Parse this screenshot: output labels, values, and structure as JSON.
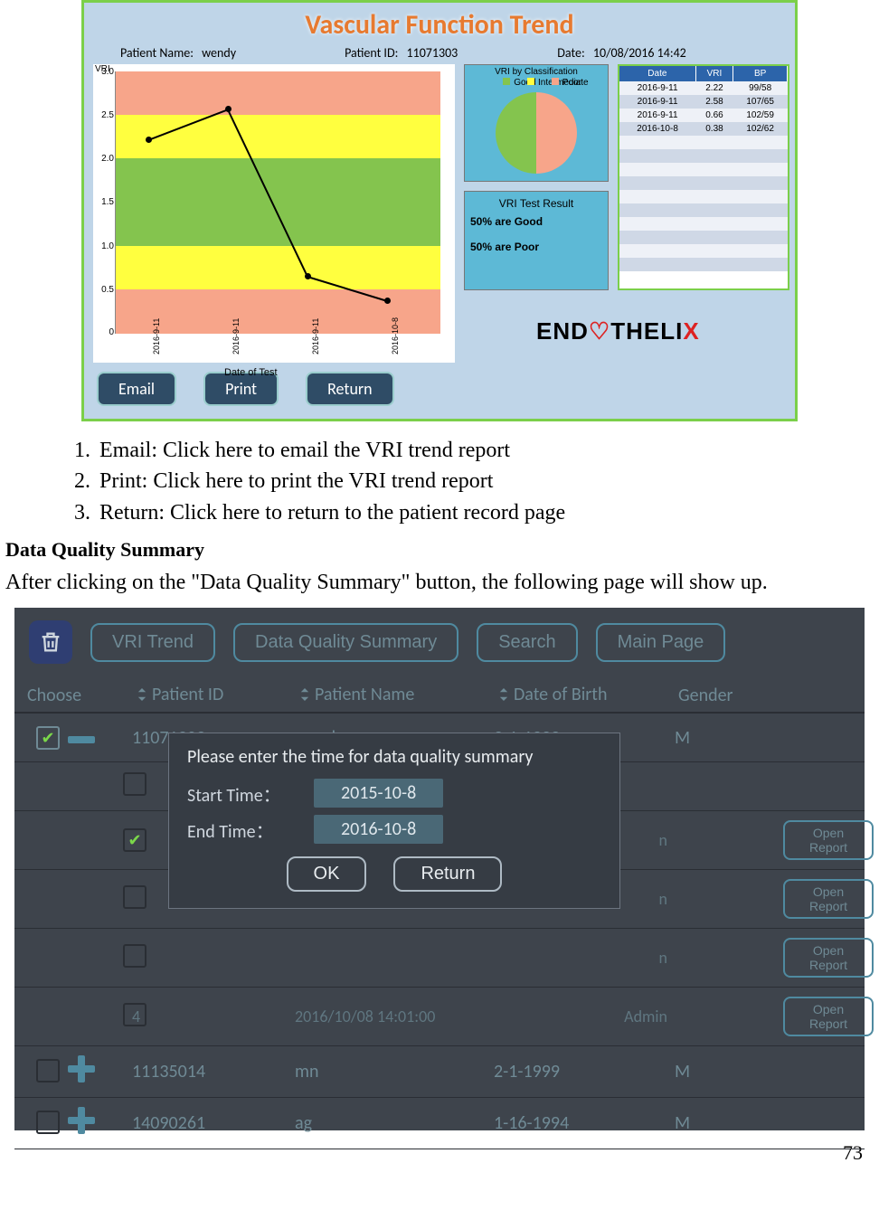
{
  "report": {
    "title": "Vascular Function Trend",
    "patient_name_label": "Patient Name:",
    "patient_name": "wendy",
    "patient_id_label": "Patient ID:",
    "patient_id": "11071303",
    "date_label": "Date:",
    "date": "10/08/2016 14:42",
    "y_axis_label": "VRI",
    "x_axis_label": "Date of Test",
    "classif_title": "VRI  by  Classification",
    "legend_good": "Good",
    "legend_int": "Intermediate",
    "legend_poor": "Poor",
    "result_title": "VRI  Test  Result",
    "result_line1": "50% are Good",
    "result_line2": "50% are Poor",
    "table": {
      "headers": [
        "Date",
        "VRI",
        "BP"
      ],
      "rows": [
        [
          "2016-9-11",
          "2.22",
          "99/58"
        ],
        [
          "2016-9-11",
          "2.58",
          "107/65"
        ],
        [
          "2016-9-11",
          "0.66",
          "102/59"
        ],
        [
          "2016-10-8",
          "0.38",
          "102/62"
        ]
      ]
    },
    "blank_rows": 10,
    "logo_prefix": "END",
    "logo_suffix": "THELI",
    "logo_x": "X",
    "buttons": {
      "email": "Email",
      "print": "Print",
      "return": "Return"
    }
  },
  "chart_data": {
    "type": "line",
    "title": "Vascular Function Trend",
    "ylabel": "VRI",
    "xlabel": "Date of Test",
    "ylim": [
      0,
      3.0
    ],
    "categories": [
      "2016-9-11",
      "2016-9-11",
      "2016-9-11",
      "2016-10-8"
    ],
    "values": [
      2.22,
      2.58,
      0.66,
      0.38
    ],
    "bands": [
      {
        "name": "Poor",
        "range": [
          2.5,
          3.0
        ],
        "color": "#f7a58a"
      },
      {
        "name": "Intermediate",
        "range": [
          2.0,
          2.5
        ],
        "color": "#ffff3f"
      },
      {
        "name": "Good",
        "range": [
          1.0,
          2.0
        ],
        "color": "#84c44e"
      },
      {
        "name": "Intermediate",
        "range": [
          0.5,
          1.0
        ],
        "color": "#ffff3f"
      },
      {
        "name": "Poor",
        "range": [
          0,
          0.5
        ],
        "color": "#f7a58a"
      }
    ],
    "yticks": [
      "3.0",
      "2.5",
      "2.0",
      "1.5",
      "1.0",
      "0.5",
      "0"
    ]
  },
  "instructions": {
    "i1": "Email: Click here to email the VRI trend report",
    "i2": "Print: Click here to print the VRI trend report",
    "i3": "Return: Click here to return to the patient record page"
  },
  "section_heading": "Data Quality Summary",
  "section_text": "After clicking on the \"Data Quality Summary\" button, the following page will show up.",
  "tablet": {
    "tabs": {
      "trend": "VRI Trend",
      "dqs": "Data Quality Summary",
      "search": "Search",
      "main": "Main Page"
    },
    "cols": {
      "choose": "Choose",
      "pid": "Patient ID",
      "pname": "Patient Name",
      "dob": "Date of Birth",
      "gender": "Gender"
    },
    "patients": [
      {
        "checked": true,
        "state": "collapse",
        "pid": "11071303",
        "name": "wendy",
        "dob": "2-1-1999",
        "gender": "M"
      },
      {
        "checked": false,
        "state": "expand",
        "pid": "11135014",
        "name": "mn",
        "dob": "2-1-1999",
        "gender": "M"
      },
      {
        "checked": false,
        "state": "expand",
        "pid": "14090261",
        "name": "ag",
        "dob": "1-16-1994",
        "gender": "M"
      }
    ],
    "subrow": {
      "idx": "4",
      "time": "2016/10/08 14:01:00",
      "by": "Admin",
      "action": "Open Report"
    },
    "other_n": "n",
    "modal": {
      "title": "Please enter the time for data quality summary",
      "start_label": "Start Time：",
      "start_val": "2015-10-8",
      "end_label": "End Time：",
      "end_val": "2016-10-8",
      "ok": "OK",
      "return": "Return"
    }
  },
  "page_number": "73"
}
